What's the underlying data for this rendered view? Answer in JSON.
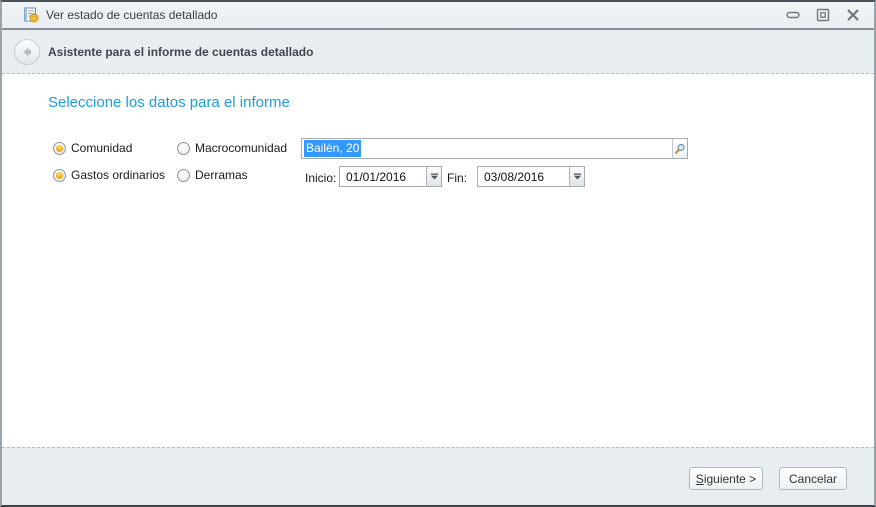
{
  "window": {
    "title": "Ver estado de cuentas detallado",
    "icon": "ledger-coin-icon",
    "controls": {
      "minimize": "minimize-icon",
      "maximize": "maximize-icon",
      "close": "close-icon"
    }
  },
  "header": {
    "back_icon": "back-arrow-icon",
    "title": "Asistente para el informe de cuentas detallado"
  },
  "form": {
    "heading": "Seleccione los datos para el informe",
    "radio_groups": {
      "scope": [
        {
          "label": "Comunidad",
          "selected": true
        },
        {
          "label": "Macrocomunidad",
          "selected": false
        }
      ],
      "type": [
        {
          "label": "Gastos ordinarios",
          "selected": true
        },
        {
          "label": "Derramas",
          "selected": false
        }
      ]
    },
    "community_search": {
      "value": "Bailén, 20",
      "text_selected": true,
      "icon": "search-icon"
    },
    "date_range": {
      "start_label": "Inicio:",
      "start_value": "01/01/2016",
      "end_label": "Fin:",
      "end_value": "03/08/2016"
    }
  },
  "footer": {
    "next_button": {
      "mnemonic": "S",
      "rest": "iguiente >"
    },
    "cancel_button": "Cancelar"
  },
  "colors": {
    "heading_blue": "#1e9cd7",
    "selection_blue": "#3399ff",
    "radio_selected_orange": "#f7a800",
    "header_bg": "#e8edf2",
    "footer_bg": "#e8edf2",
    "titlebar_bg": "#edf0f4"
  }
}
